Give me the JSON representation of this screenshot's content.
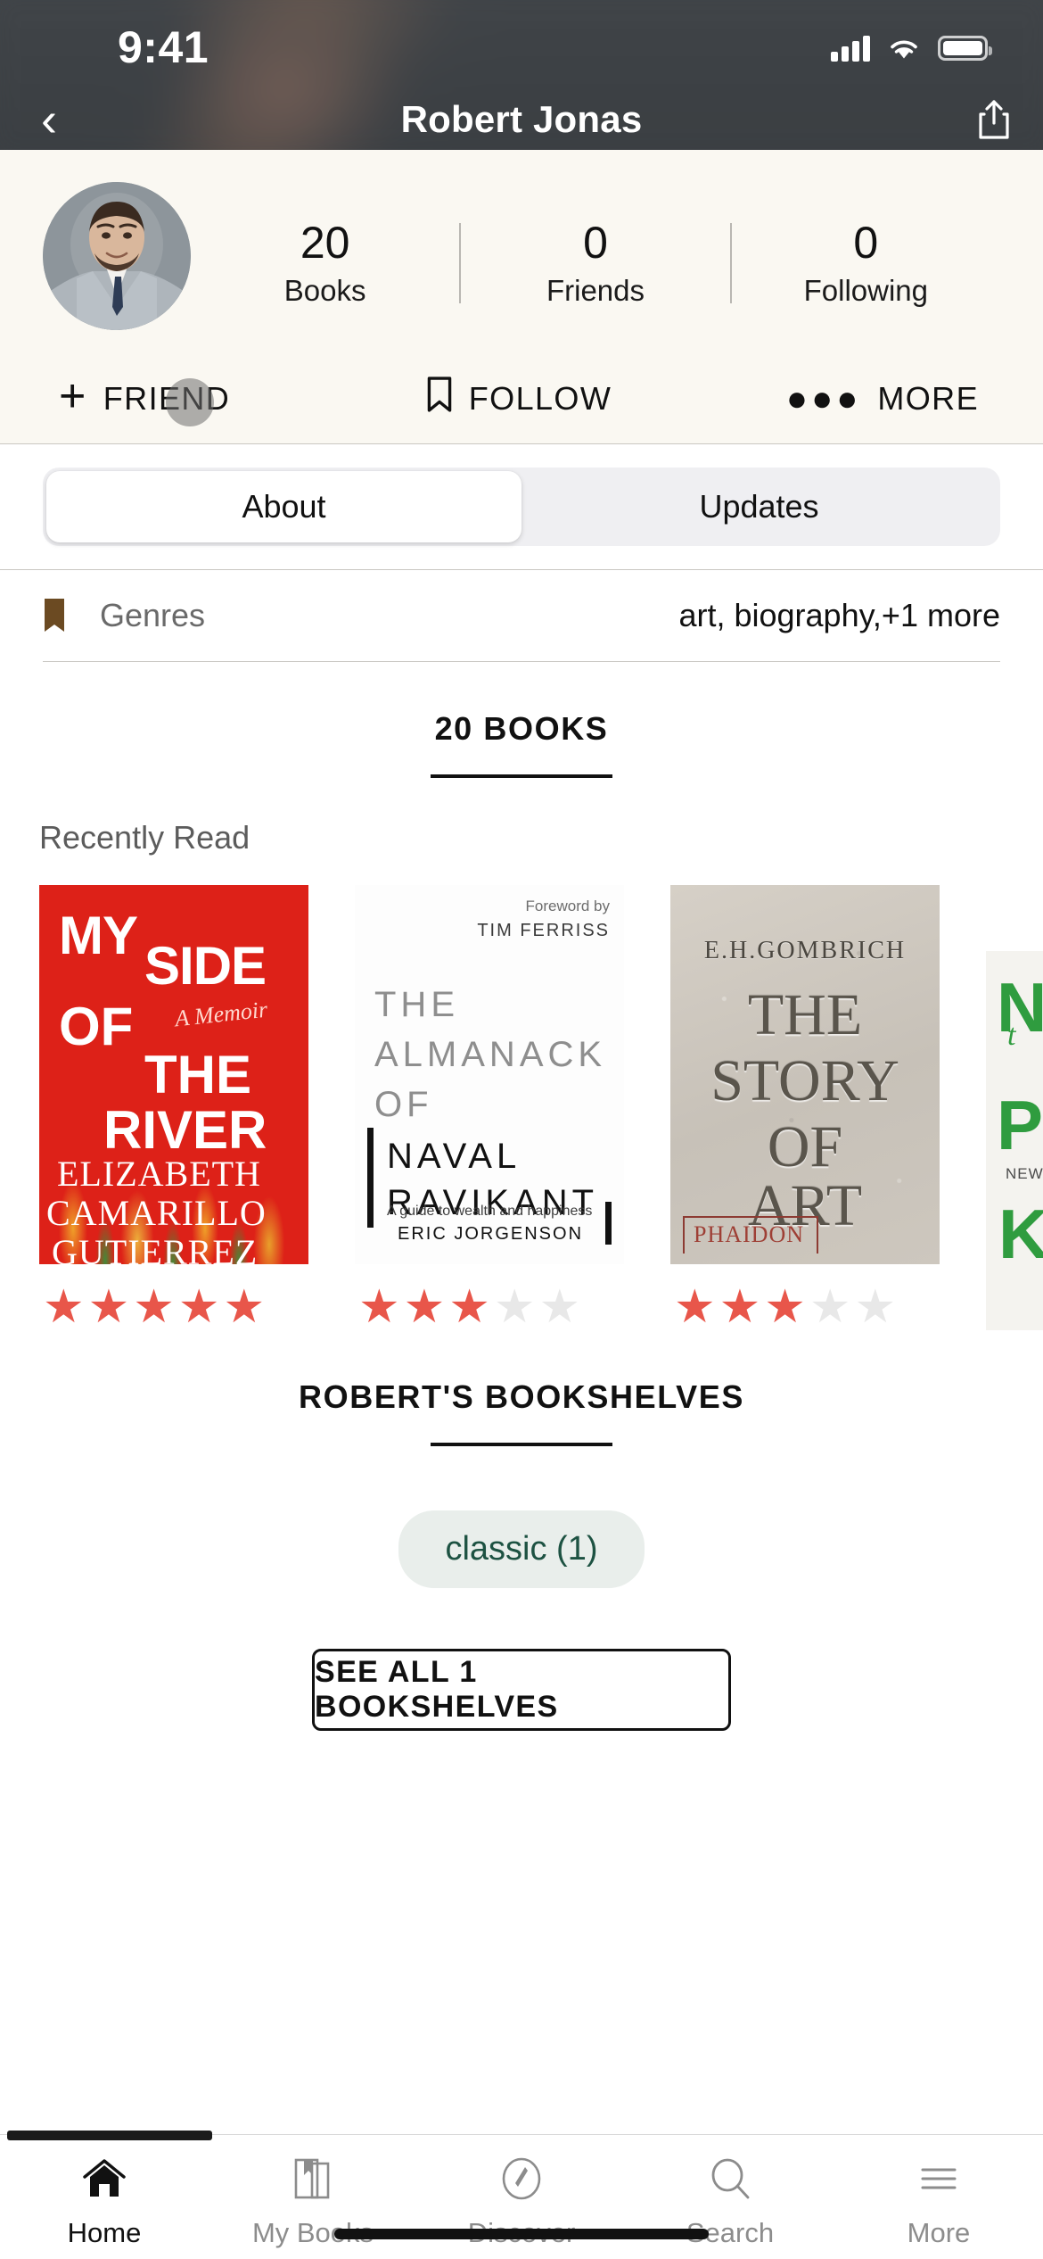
{
  "status_bar": {
    "time": "9:41",
    "signal_icon": "cellular-signal-icon",
    "wifi_icon": "wifi-icon",
    "battery_icon": "battery-icon"
  },
  "nav": {
    "back_icon": "chevron-left-icon",
    "title": "Robert Jonas",
    "share_icon": "share-icon"
  },
  "profile": {
    "avatar_name": "Robert Jonas",
    "stats": [
      {
        "value": "20",
        "label": "Books"
      },
      {
        "value": "0",
        "label": "Friends"
      },
      {
        "value": "0",
        "label": "Following"
      }
    ],
    "actions": [
      {
        "icon": "plus-icon",
        "label": "FRIEND"
      },
      {
        "icon": "bookmark-icon",
        "label": "FOLLOW"
      },
      {
        "icon": "ellipsis-icon",
        "label": "MORE"
      }
    ]
  },
  "tabs": {
    "items": [
      {
        "label": "About",
        "active": true
      },
      {
        "label": "Updates",
        "active": false
      }
    ]
  },
  "genres": {
    "icon": "bookmark-icon",
    "label": "Genres",
    "value": "art, biography,+1 more",
    "accent": "#6b4a22"
  },
  "books_section": {
    "heading": "20 BOOKS",
    "subheading": "Recently Read",
    "books": [
      {
        "title": "MY SIDE OF THE RIVER",
        "author": "ELIZABETH CAMARILLO GUTIERREZ",
        "rating": 5,
        "cover": {
          "line1": "MY",
          "line2": "SIDE",
          "line3": "OF",
          "line4": "THE",
          "line5": "RIVER",
          "memoir": "A Memoir",
          "author_line1": "ELIZABETH",
          "author_line2": "CAMARILLO",
          "author_line3": "GUTIERREZ"
        }
      },
      {
        "title": "THE ALMANACK OF NAVAL RAVIKANT",
        "author": "ERIC JORGENSON",
        "rating": 3,
        "cover": {
          "foreword_by": "Foreword by",
          "foreword_name": "TIM FERRISS",
          "line1": "THE",
          "line2": "ALMANACK",
          "line3": "OF",
          "line4": "NAVAL",
          "line5": "RAVIKANT",
          "subtitle": "A guide to wealth and happiness",
          "author_line": "ERIC JORGENSON"
        }
      },
      {
        "title": "THE STORY OF ART",
        "author": "E.H.GOMBRICH",
        "rating": 3,
        "cover": {
          "author_line": "E.H.GOMBRICH",
          "line1": "THE",
          "line2": "STORY",
          "line3": "OF",
          "line4": "ART",
          "publisher": "PHAIDON"
        }
      },
      {
        "title": "",
        "author": "",
        "rating": 0,
        "cover": {
          "line1": "N",
          "line2": "t",
          "line3": "P",
          "line4": "NEW",
          "line5": "K"
        }
      }
    ]
  },
  "bookshelves_section": {
    "heading": "ROBERT'S BOOKSHELVES",
    "chips": [
      {
        "label": "classic (1)"
      }
    ],
    "see_all_label": "SEE ALL 1 BOOKSHELVES"
  },
  "bottom_nav": {
    "items": [
      {
        "icon": "home-icon",
        "label": "Home",
        "active": true
      },
      {
        "icon": "books-icon",
        "label": "My Books",
        "active": false
      },
      {
        "icon": "compass-icon",
        "label": "Discover",
        "active": false
      },
      {
        "icon": "search-icon",
        "label": "Search",
        "active": false
      },
      {
        "icon": "menu-icon",
        "label": "More",
        "active": false
      }
    ]
  }
}
